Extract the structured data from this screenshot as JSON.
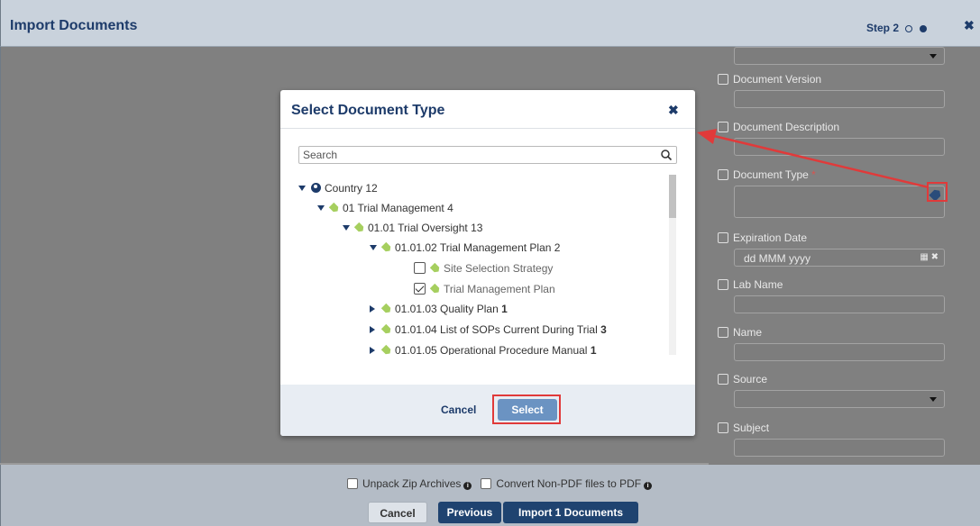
{
  "window": {
    "title": "Import Documents",
    "step_label": "Step 2"
  },
  "form": {
    "fields": {
      "document_version": "Document Version",
      "document_description": "Document Description",
      "document_type": "Document Type",
      "document_type_required_mark": "*",
      "expiration_date": "Expiration Date",
      "expiration_date_placeholder": "dd MMM yyyy",
      "lab_name": "Lab Name",
      "name": "Name",
      "source": "Source",
      "subject": "Subject"
    }
  },
  "footer": {
    "unpack_zip_label": "Unpack Zip Archives",
    "convert_pdf_label": "Convert Non-PDF files to PDF",
    "cancel_label": "Cancel",
    "previous_label": "Previous",
    "import_label": "Import 1 Documents"
  },
  "modal": {
    "title": "Select Document Type",
    "search_placeholder": "Search",
    "cancel_label": "Cancel",
    "select_label": "Select",
    "tree": [
      {
        "label": "Country",
        "count": "12",
        "bold_count": false,
        "expanded": true,
        "icon": "globe-icon"
      },
      {
        "label": "01 Trial Management",
        "count": "4",
        "bold_count": false,
        "expanded": true,
        "icon": "tag-icon"
      },
      {
        "label": "01.01 Trial Oversight",
        "count": "13",
        "bold_count": false,
        "expanded": true,
        "icon": "tag-icon"
      },
      {
        "label": "01.01.02 Trial Management Plan",
        "count": "2",
        "bold_count": false,
        "expanded": true,
        "icon": "tag-icon"
      },
      {
        "label": "Site Selection Strategy",
        "checked": false,
        "icon": "tag-icon"
      },
      {
        "label": "Trial Management Plan",
        "checked": true,
        "icon": "tag-icon"
      },
      {
        "label": "01.01.03 Quality Plan",
        "count": "1",
        "bold_count": true,
        "expanded": false,
        "icon": "tag-icon"
      },
      {
        "label": "01.01.04 List of SOPs Current During Trial",
        "count": "3",
        "bold_count": true,
        "expanded": false,
        "icon": "tag-icon"
      },
      {
        "label": "01.01.05 Operational Procedure Manual",
        "count": "1",
        "bold_count": true,
        "expanded": false,
        "icon": "tag-icon"
      }
    ]
  },
  "colors": {
    "brand_navy": "#1d3b6a",
    "highlight_red": "#e03a3a",
    "tag_green": "#a6cf5f"
  }
}
